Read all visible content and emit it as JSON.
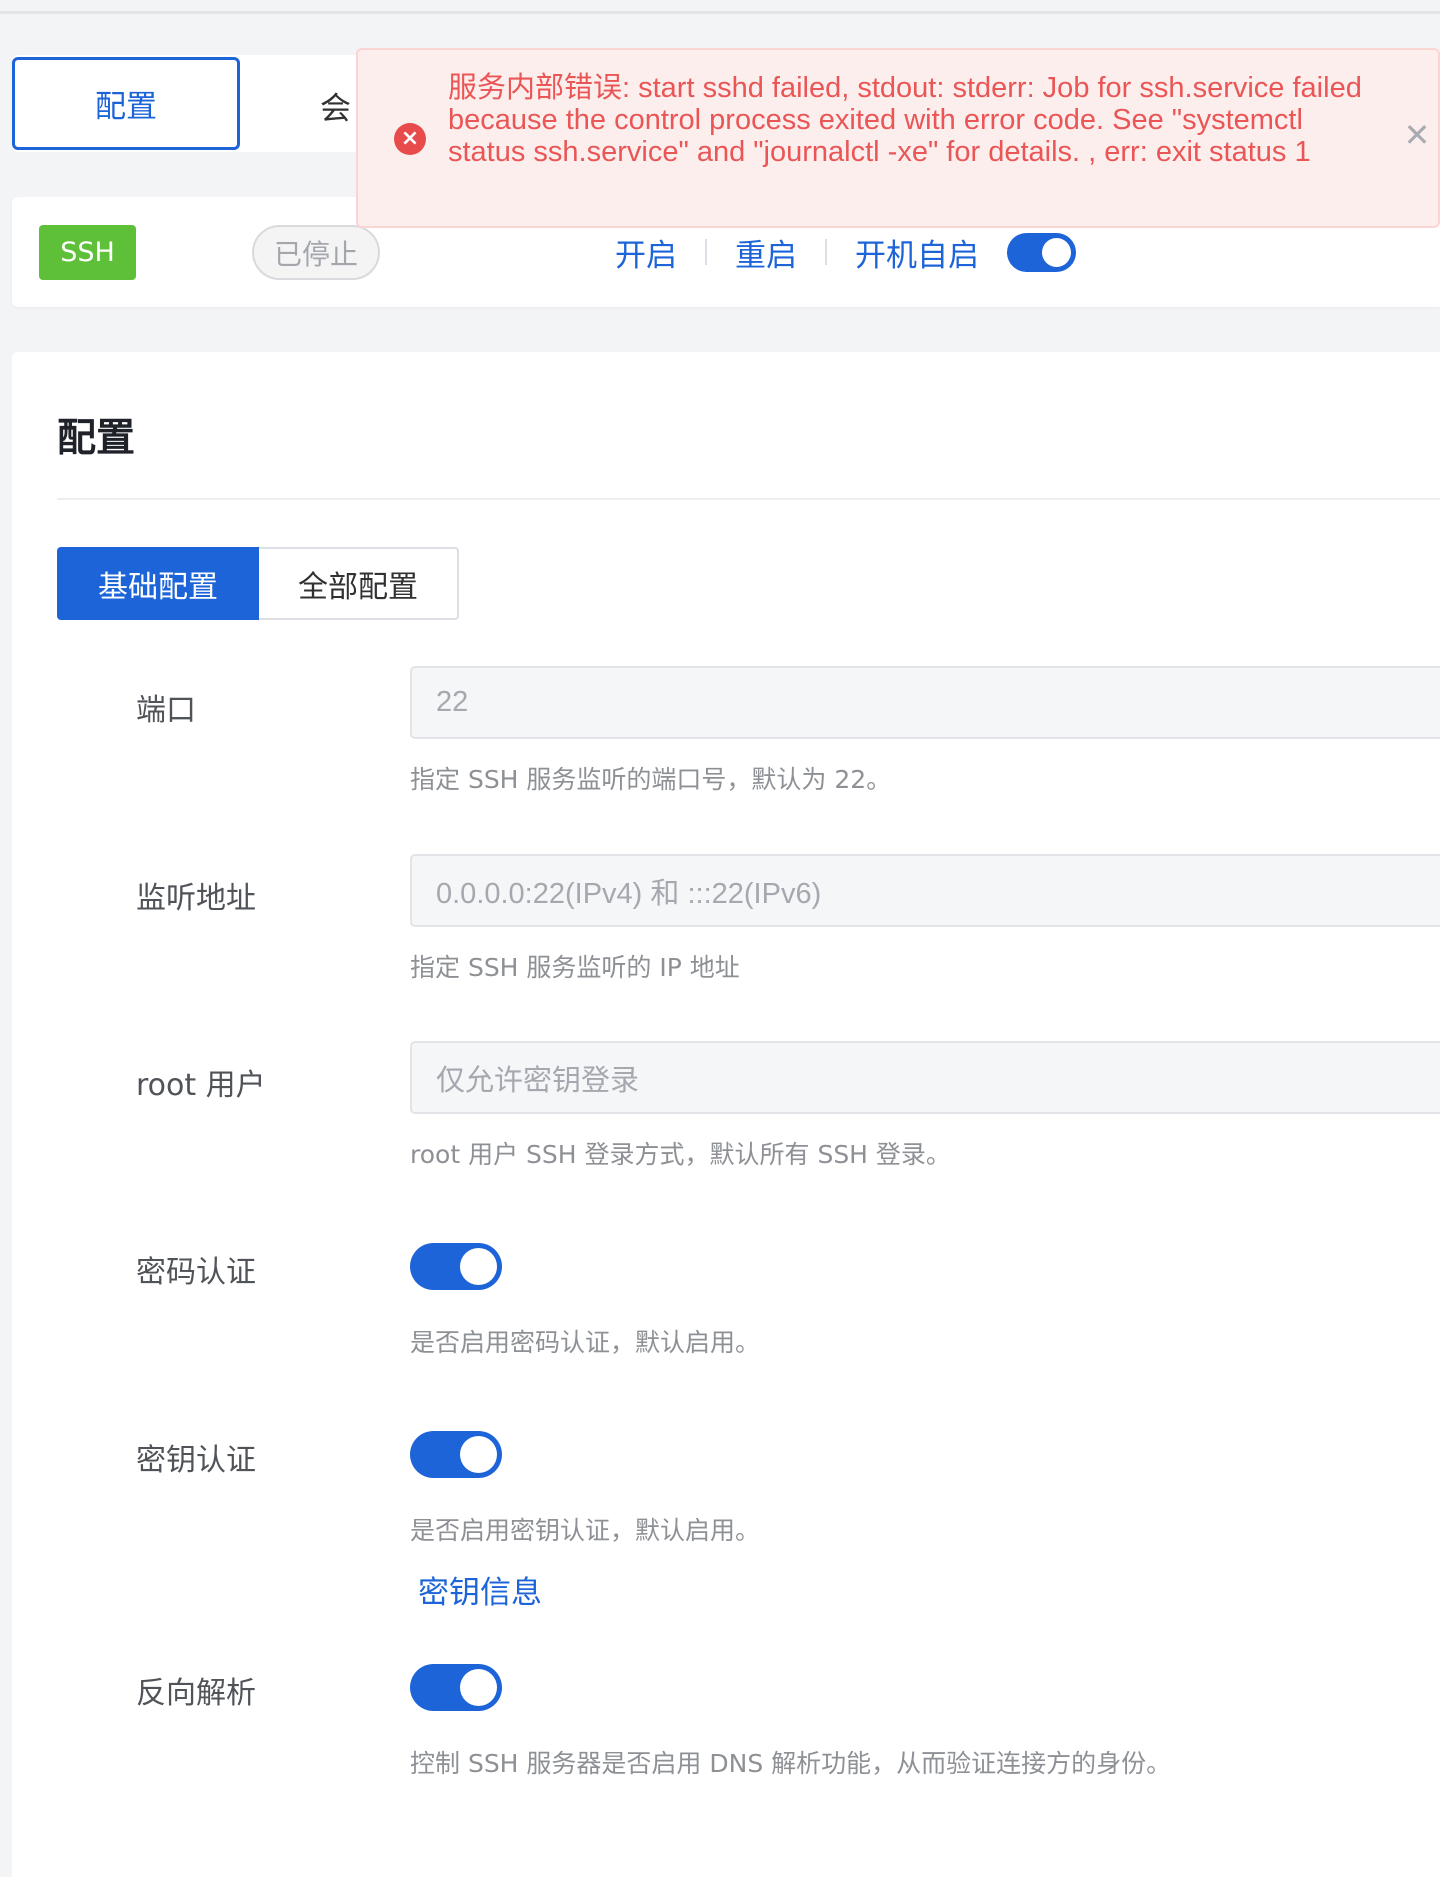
{
  "top_tabs": [
    {
      "label": "配置"
    },
    {
      "label": "会"
    }
  ],
  "service": {
    "name_tag": "SSH",
    "status": "已停止",
    "actions": [
      "开启",
      "重启",
      "开机自启"
    ],
    "autostart_enabled": true
  },
  "toast": {
    "icon": "error-circle-icon",
    "message": "服务内部错误: start sshd failed, stdout: stderr: Job for ssh.service failed because the control process exited with error code. See \"systemctl status ssh.service\" and \"journalctl -xe\" for details. , err: exit status 1",
    "close_icon": "close-icon"
  },
  "config": {
    "title": "配置",
    "tabs": [
      "基础配置",
      "全部配置"
    ],
    "port": {
      "label": "端口",
      "value": "22",
      "hint": "指定 SSH 服务监听的端口号，默认为 22。"
    },
    "listen": {
      "label": "监听地址",
      "value": "0.0.0.0:22(IPv4) 和 :::22(IPv6)",
      "hint": "指定 SSH 服务监听的 IP 地址"
    },
    "root": {
      "label": "root 用户",
      "value": "仅允许密钥登录",
      "hint": "root 用户 SSH 登录方式，默认所有 SSH 登录。"
    },
    "password_auth": {
      "label": "密码认证",
      "enabled": true,
      "hint": "是否启用密码认证，默认启用。"
    },
    "key_auth": {
      "label": "密钥认证",
      "enabled": true,
      "hint": "是否启用密钥认证，默认启用。",
      "link": "密钥信息"
    },
    "reverse_dns": {
      "label": "反向解析",
      "enabled": true,
      "hint": "控制 SSH 服务器是否启用 DNS 解析功能，从而验证连接方的身份。"
    }
  },
  "colors": {
    "primary": "#1d64d8",
    "success": "#5ec038",
    "error": "#ea5656"
  }
}
